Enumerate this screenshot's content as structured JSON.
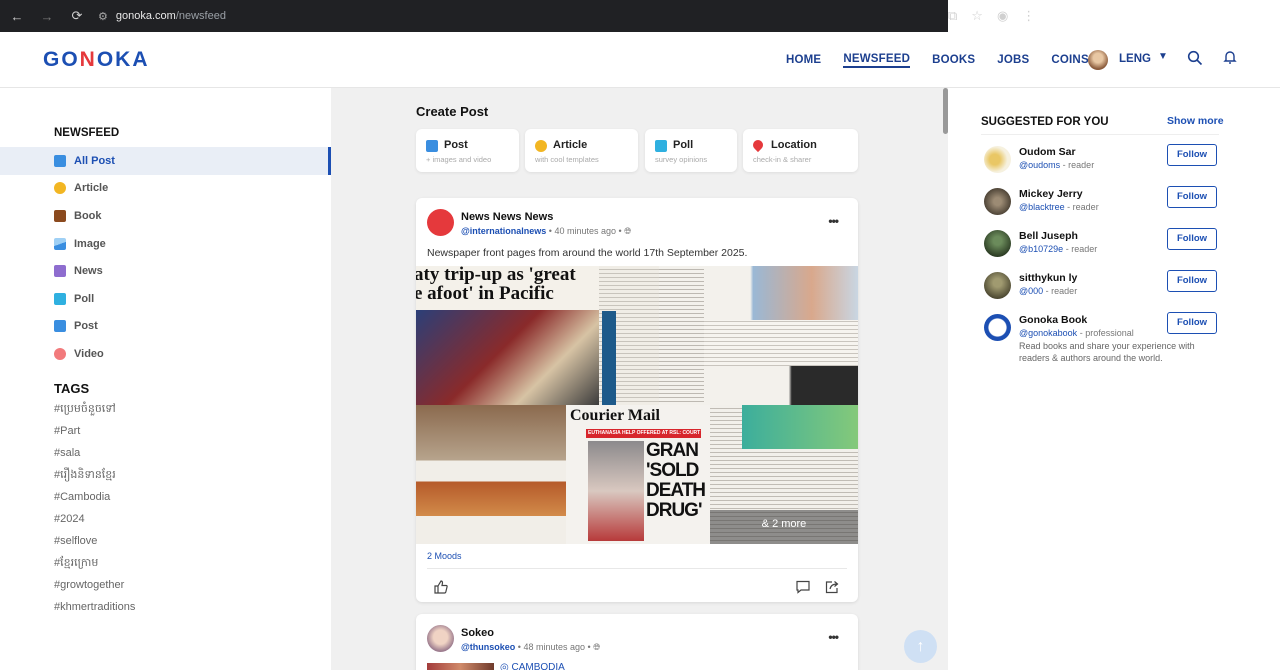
{
  "browser": {
    "url_host": "gonoka.com",
    "url_path": "/newsfeed"
  },
  "header": {
    "logo": "GONOKA",
    "nav": [
      "HOME",
      "NEWSFEED",
      "BOOKS",
      "JOBS",
      "COINS"
    ],
    "active_nav": "NEWSFEED",
    "user_name": "LENG"
  },
  "sidebar": {
    "section_title": "NEWSFEED",
    "items": [
      {
        "label": "All Post",
        "icon": "all-post-icon",
        "color": "#3a8ee0",
        "active": true
      },
      {
        "label": "Article",
        "icon": "bulb-icon",
        "color": "#f2b623"
      },
      {
        "label": "Book",
        "icon": "book-icon",
        "color": "#8b4a1e"
      },
      {
        "label": "Image",
        "icon": "image-icon",
        "color": "#3a8ee0"
      },
      {
        "label": "News",
        "icon": "news-icon",
        "color": "#8e6dcf"
      },
      {
        "label": "Poll",
        "icon": "poll-icon",
        "color": "#2fb0e0"
      },
      {
        "label": "Post",
        "icon": "post-icon",
        "color": "#3a8ee0"
      },
      {
        "label": "Video",
        "icon": "video-icon",
        "color": "#e5393c"
      }
    ],
    "tags_title": "TAGS",
    "tags": [
      "#ប្រេមចំនួចទៅ",
      "#Part",
      "#sala",
      "#រឿងនិទានខ្មែរ",
      "#Cambodia",
      "#2024",
      "#selflove",
      "#ខ្មែរក្រោម",
      "#growtogether",
      "#khmertraditions"
    ]
  },
  "create_post": {
    "title": "Create Post",
    "options": [
      {
        "label": "Post",
        "sub": "+ images and video",
        "color": "#3a8ee0"
      },
      {
        "label": "Article",
        "sub": "with cool templates",
        "color": "#f2b623"
      },
      {
        "label": "Poll",
        "sub": "survey opinions",
        "color": "#2fb0e0"
      },
      {
        "label": "Location",
        "sub": "check-in & sharer",
        "color": "#e5393c"
      }
    ]
  },
  "posts": [
    {
      "author": "News News News",
      "handle": "@internationalnews",
      "time": "40 minutes ago",
      "text": "Newspaper front pages from around the world 17th September 2025.",
      "images": {
        "headline_1": "aty trip-up as 'great",
        "headline_2": "e afoot' in Pacific",
        "courier": "Courier Mail",
        "banner": "EUTHANASIA HELP OFFERED AT RSL: COURT",
        "gran": "GRAN 'SOLD DEATH DRUG'",
        "more": "& 2 more"
      },
      "moods": "2 Moods"
    },
    {
      "author": "Sokeo",
      "handle": "@thunsokeo",
      "time": "48 minutes ago",
      "location": "CAMBODIA"
    }
  ],
  "suggested": {
    "title": "SUGGESTED FOR YOU",
    "show_more": "Show more",
    "follow_label": "Follow",
    "people": [
      {
        "name": "Oudom Sar",
        "handle": "@oudoms",
        "role": "- reader",
        "color": "#e9d9a0"
      },
      {
        "name": "Mickey Jerry",
        "handle": "@blacktree",
        "role": "- reader",
        "color": "#7a6a55"
      },
      {
        "name": "Bell Juseph",
        "handle": "@b10729e",
        "role": "- reader",
        "color": "#3c5a34"
      },
      {
        "name": "sitthykun ly",
        "handle": "@000",
        "role": "- reader",
        "color": "#6d6a48"
      },
      {
        "name": "Gonoka Book",
        "handle": "@gonokabook",
        "role": "- professional",
        "desc": "Read books and share your experience with readers & authors around the world.",
        "color": "#1c4fb3"
      }
    ]
  }
}
